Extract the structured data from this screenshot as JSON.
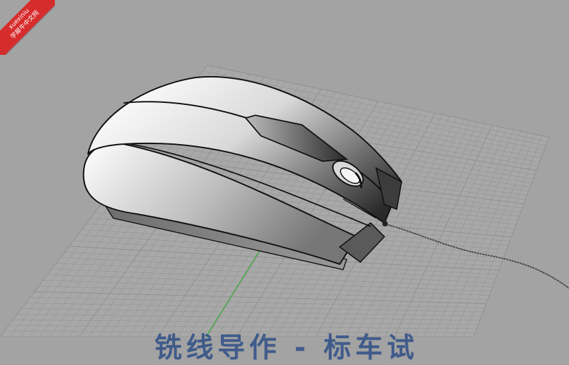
{
  "watermark": {
    "line1": "xuexiniu",
    "line2": "学犀牛中文网",
    "color": "#d72c2c"
  },
  "caption": {
    "text": "铣线导作 - 标车试"
  },
  "viewport": {
    "background": "#a3a3a3",
    "grid_color": "#8e8e8e",
    "axis_color": "#3aa83a",
    "icons": [
      "mouse-model",
      "mouse-cable",
      "scroll-wheel-icon"
    ]
  }
}
